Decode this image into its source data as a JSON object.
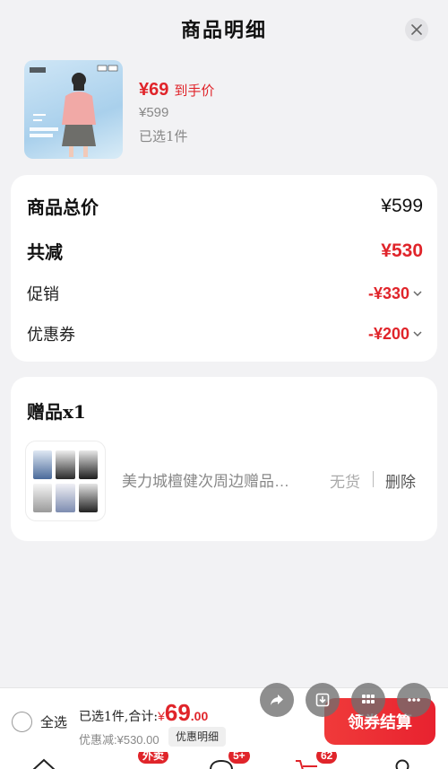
{
  "header": {
    "title": "商品明细"
  },
  "product": {
    "price_now": "¥69",
    "price_tag": "到手价",
    "price_original": "¥599",
    "selected": "已选1件"
  },
  "summary": {
    "total_label": "商品总价",
    "total_value": "¥599",
    "reduce_label": "共减",
    "reduce_value": "¥530",
    "promo_label": "促销",
    "promo_value": "-¥330",
    "coupon_label": "优惠券",
    "coupon_value": "-¥200"
  },
  "gift": {
    "title": "赠品x1",
    "name": "美力城檀健次周边赠品…",
    "stock": "无货",
    "delete": "删除"
  },
  "footer": {
    "select_all": "全选",
    "total_prefix": "已选1件,合计:",
    "currency": "¥",
    "total_int": "69",
    "total_dec": ".00",
    "discount": "优惠减:¥530.00",
    "detail_button": "优惠明细",
    "checkout_button": "领券结算"
  },
  "tabbar": {
    "takeout_badge": "外卖",
    "message_badge": "5+",
    "cart_badge": "62"
  },
  "colors": {
    "accent_red": "#e0242a",
    "background": "#f2f2f4"
  }
}
